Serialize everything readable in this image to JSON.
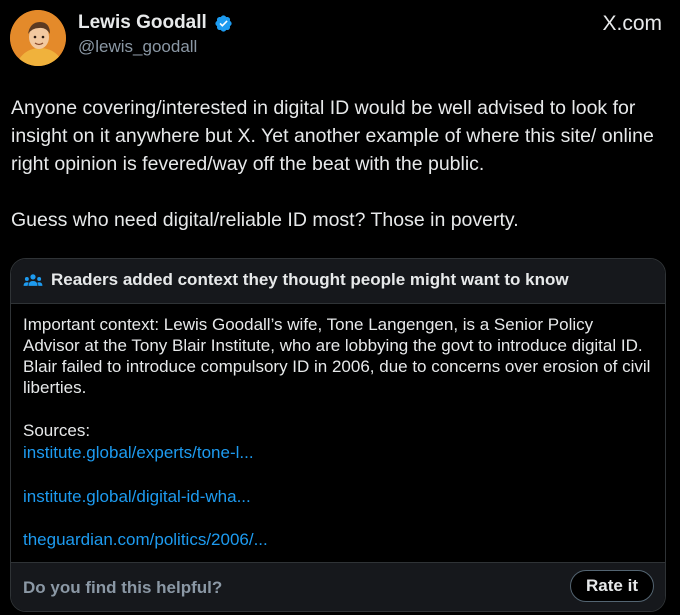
{
  "tweet": {
    "author": {
      "display_name": "Lewis Goodall",
      "handle": "@lewis_goodall",
      "verified_icon": "verified-badge-icon",
      "verified_color": "#1d9bf0"
    },
    "brand": "X.com",
    "paragraphs": [
      "Anyone covering/interested in digital ID would be well advised to look for insight on it anywhere but X. Yet another example of where this site/ online right opinion is fevered/way off the beat with the public.",
      "Guess who need digital/reliable ID most? Those in poverty."
    ]
  },
  "community_note": {
    "header_icon": "people-icon",
    "title": "Readers added context they thought people might want to know",
    "body": "Important context: Lewis Goodall’s wife, Tone Langengen, is a Senior Policy Advisor at the Tony Blair Institute, who are lobbying the govt to introduce digital ID. Blair failed to introduce compulsory ID in 2006, due to concerns over erosion of civil liberties.",
    "sources_label": "Sources:",
    "sources": [
      "institute.global/experts/tone-l...",
      "institute.global/digital-id-wha...",
      "theguardian.com/politics/2006/..."
    ],
    "footer_question": "Do you find this helpful?",
    "rate_button": "Rate it",
    "link_color": "#1d9bf0"
  }
}
